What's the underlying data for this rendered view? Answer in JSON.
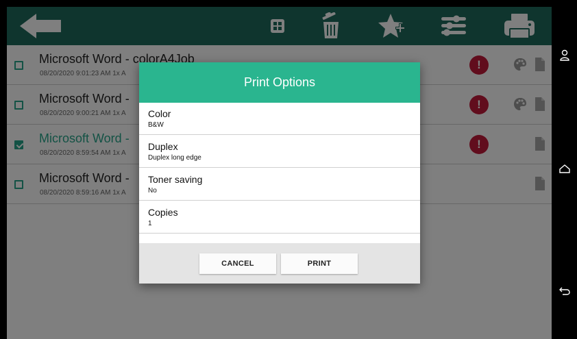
{
  "toolbar": {
    "icons": [
      "back-arrow-icon",
      "select-all-icon",
      "trash-icon",
      "favorite-add-icon",
      "settings-sliders-icon",
      "printer-icon"
    ]
  },
  "jobs": [
    {
      "title": "Microsoft Word - colorA4Job",
      "subtitle": "08/20/2020 9:01:23 AM 1x A",
      "checked": false,
      "alert": true,
      "color": true
    },
    {
      "title": "Microsoft Word -",
      "subtitle": "08/20/2020 9:00:21 AM 1x A",
      "checked": false,
      "alert": true,
      "color": true
    },
    {
      "title": "Microsoft Word -",
      "subtitle": "08/20/2020 8:59:54 AM 1x A",
      "checked": true,
      "alert": true,
      "color": false
    },
    {
      "title": "Microsoft Word -",
      "subtitle": "08/20/2020 8:59:16 AM 1x A",
      "checked": false,
      "alert": false,
      "color": false
    }
  ],
  "alert_symbol": "!",
  "dialog": {
    "title": "Print Options",
    "options": [
      {
        "label": "Color",
        "value": "B&W"
      },
      {
        "label": "Duplex",
        "value": "Duplex long edge"
      },
      {
        "label": "Toner saving",
        "value": "No"
      },
      {
        "label": "Copies",
        "value": "1"
      }
    ],
    "cancel_label": "CANCEL",
    "print_label": "PRINT"
  },
  "colors": {
    "toolbar": "#1e6b5d",
    "accent": "#2ab58f",
    "alert": "#c21b3a"
  },
  "navbar": {
    "icons": [
      "user-icon",
      "home-icon",
      "back-icon"
    ]
  }
}
